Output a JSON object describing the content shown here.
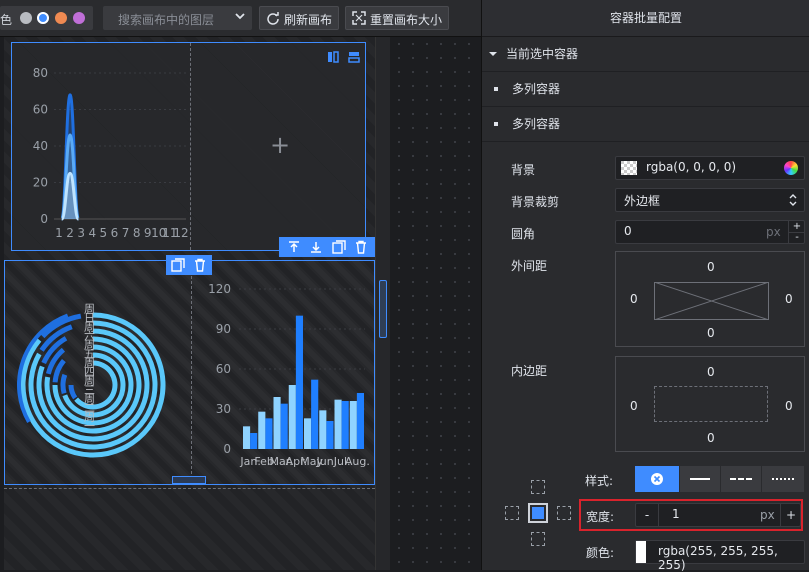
{
  "toolbar": {
    "theme_label": "色",
    "theme_colors": [
      "#b9bcc2",
      "#3f8cff",
      "#f08a52",
      "#c06fd8"
    ],
    "search_placeholder": "搜索画布中的图层",
    "refresh_label": "刷新画布",
    "reset_size_label": "重置画布大小"
  },
  "canvas": {
    "add_symbol": "+",
    "container_tools": [
      "copy-icon",
      "delete-icon"
    ],
    "layer_tools": [
      "move-top-icon",
      "move-bottom-icon",
      "copy-icon",
      "delete-icon"
    ]
  },
  "chart_data": [
    {
      "type": "area",
      "x": [
        "1",
        "2",
        "3",
        "4",
        "5",
        "6",
        "7",
        "8",
        "9",
        "10",
        "11",
        "12"
      ],
      "y_ticks": [
        "0",
        "20",
        "40",
        "60",
        "80"
      ],
      "x_tick_labels": [
        "1",
        "2",
        "3",
        "4",
        "5",
        "6",
        "7",
        "8",
        "9",
        "10",
        "11",
        "12"
      ],
      "ylim": [
        0,
        80
      ],
      "series": [
        {
          "values": [
            0,
            68,
            0,
            0,
            0,
            0,
            0,
            0,
            0,
            0,
            0,
            0
          ],
          "color": "#1f6fe0"
        },
        {
          "values": [
            0,
            46,
            0,
            0,
            0,
            0,
            0,
            0,
            0,
            0,
            0,
            0
          ],
          "color": "#5aaaf5"
        },
        {
          "values": [
            0,
            25,
            0,
            0,
            0,
            0,
            0,
            0,
            0,
            0,
            0,
            0
          ],
          "color": "#bfe4ff"
        }
      ]
    },
    {
      "type": "pie",
      "subtype": "radial-bar",
      "legend_text": "周日周六周五周四周三周二周一",
      "ring_colors": [
        "#5ac8fa",
        "#1f6fe0"
      ]
    },
    {
      "type": "bar",
      "categories": [
        "Jan.",
        "Feb.",
        "Mar.",
        "Apr.",
        "May",
        "Jun.",
        "Jul.",
        "Aug."
      ],
      "y_ticks": [
        "0",
        "30",
        "60",
        "90",
        "120"
      ],
      "ylim": [
        0,
        120
      ],
      "series": [
        {
          "values": [
            17,
            28,
            39,
            48,
            23,
            29,
            37,
            36
          ],
          "color": "#8fd3ff"
        },
        {
          "values": [
            12,
            23,
            34,
            100,
            52,
            21,
            36,
            42
          ],
          "color": "#1f7fff"
        }
      ]
    }
  ],
  "panel": {
    "title": "容器批量配置",
    "current_section": "当前选中容器",
    "items": [
      "多列容器",
      "多列容器"
    ],
    "bg_label": "背景",
    "bg_value": "rgba(0, 0, 0, 0)",
    "clip_label": "背景裁剪",
    "clip_value": "外边框",
    "radius_label": "圆角",
    "radius_value": "0",
    "radius_unit": "px",
    "margin_label": "外间距",
    "margin": {
      "top": "0",
      "right": "0",
      "bottom": "0",
      "left": "0"
    },
    "padding_label": "内边距",
    "padding": {
      "top": "0",
      "right": "0",
      "bottom": "0",
      "left": "0"
    },
    "style_label": "样式:",
    "width_label": "宽度:",
    "width_value": "1",
    "width_unit": "px",
    "width_minus": "-",
    "width_plus": "+",
    "color_label": "颜色:",
    "color_value": "rgba(255, 255, 255, 255)"
  }
}
